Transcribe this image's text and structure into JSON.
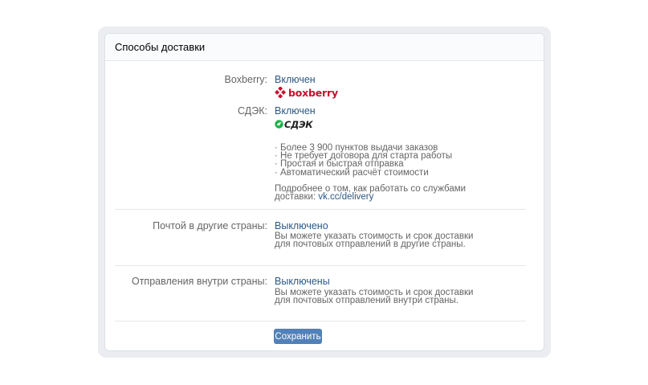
{
  "panel": {
    "title": "Способы доставки"
  },
  "boxberry": {
    "label": "Boxberry:",
    "status": "Включен",
    "logo_text": "boxberry"
  },
  "cdek": {
    "label": "СДЭК:",
    "status": "Включен",
    "logo_text": "СДЭК",
    "features": [
      "· Более 3 900 пунктов выдачи заказов",
      "· Не требует договора для старта работы",
      "· Простая и быстрая отправка",
      "· Автоматический расчёт стоимости"
    ],
    "more_info_line1": "Подробнее о том, как работать со службами",
    "more_info_prefix": "доставки: ",
    "more_info_link": "vk.cc/delivery"
  },
  "international": {
    "label": "Почтой в другие страны:",
    "status": "Выключено",
    "description_lines": [
      "Вы можете указать стоимость и срок доставки",
      "для почтовых отправлений в другие страны."
    ]
  },
  "domestic": {
    "label": "Отправления внутри страны:",
    "status": "Выключены",
    "description_lines": [
      "Вы можете указать стоимость и срок доставки",
      "для почтовых отправлений внутри страны."
    ]
  },
  "actions": {
    "save_label": "Сохранить"
  },
  "colors": {
    "accent": "#5181b8",
    "link": "#2a5885",
    "boxberry_brand": "#c8102e",
    "cdek_brand": "#1ab248"
  }
}
